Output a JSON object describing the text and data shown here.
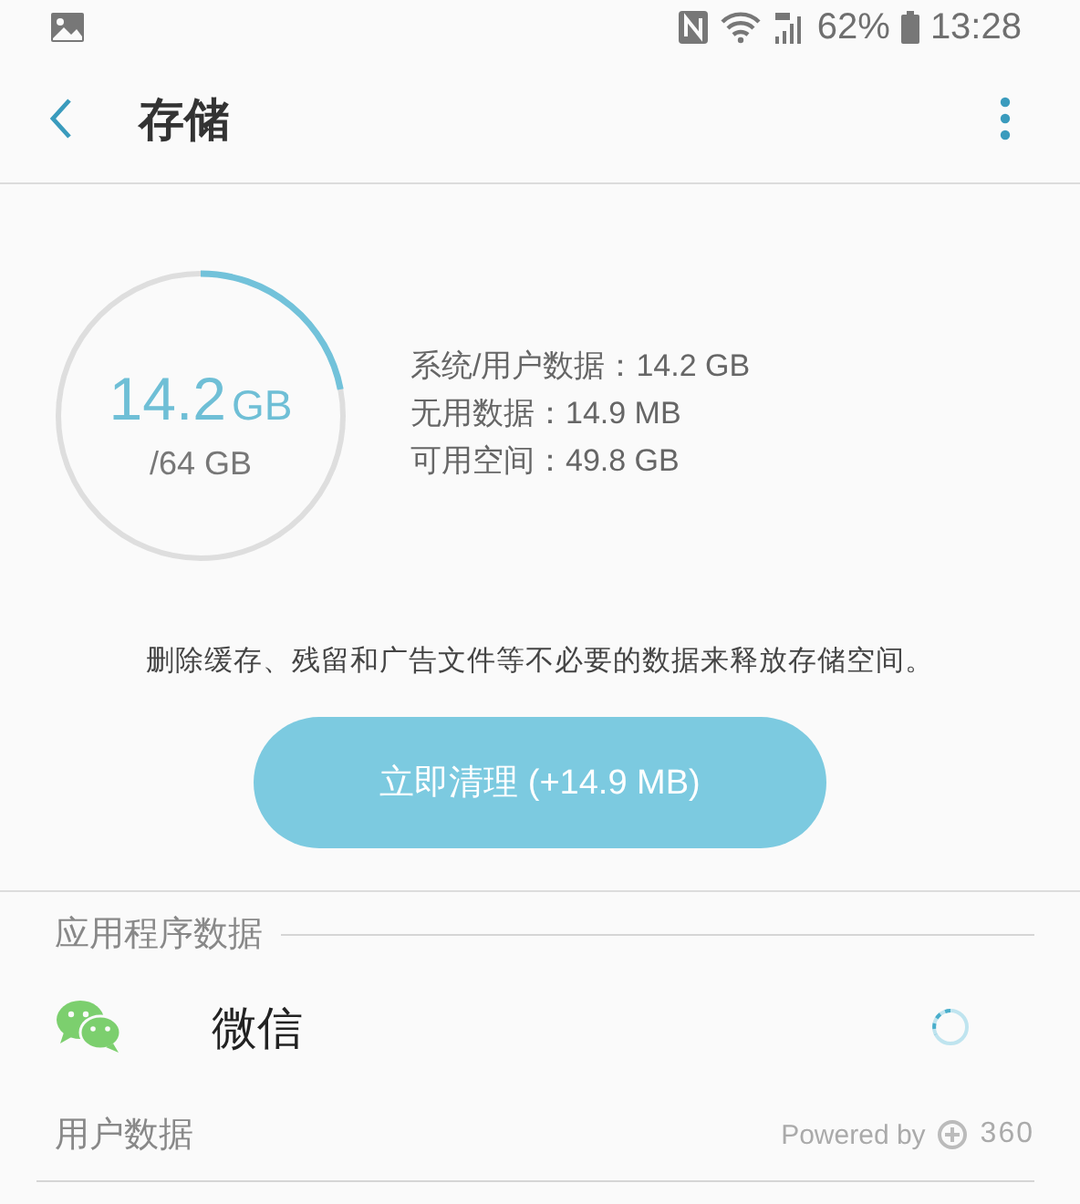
{
  "status_bar": {
    "battery": "62%",
    "time": "13:28"
  },
  "app_bar": {
    "title": "存储"
  },
  "storage": {
    "used": "14.2",
    "used_unit": "GB",
    "total": "/64 GB",
    "level": 0.22,
    "details": [
      "系统/用户数据：14.2 GB",
      "无用数据：14.9 MB",
      "可用空间：49.8 GB"
    ]
  },
  "description": "删除缓存、残留和广告文件等不必要的数据来释放存储空间。",
  "clean_button": "立即清理 (+14.9 MB)",
  "sections": [
    {
      "title": "应用程序数据",
      "items": [
        {
          "name": "微信",
          "loading": true
        }
      ]
    },
    {
      "title": "用户数据"
    }
  ],
  "footer": {
    "powered_by": "Powered by",
    "brand": "360"
  }
}
